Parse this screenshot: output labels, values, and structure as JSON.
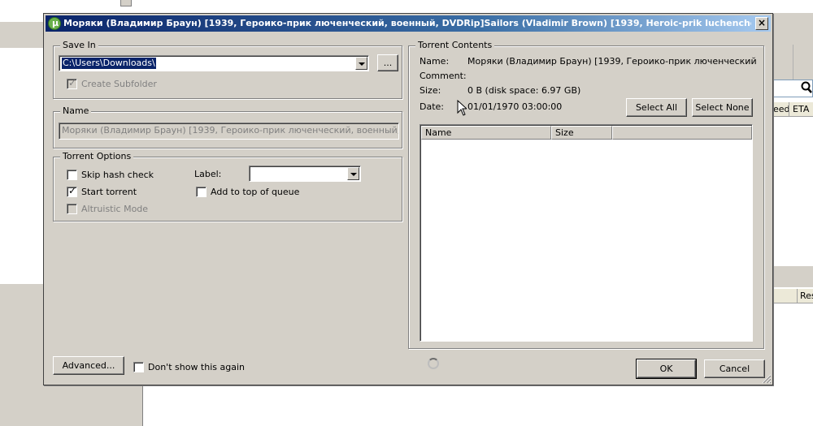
{
  "dialog": {
    "title": "Моряки (Владимир Браун) [1939, Героико-прик люченческий, военный, DVDRip]Sailors (Vladimir Brown) [1939, Heroic-prik luchenchesky, military, ...",
    "close_glyph": "×"
  },
  "save_in": {
    "legend": "Save In",
    "path": "C:\\Users\\Downloads\\",
    "browse_label": "...",
    "create_subfolder_label": "Create Subfolder",
    "create_subfolder_checked": true,
    "create_subfolder_enabled": false
  },
  "name_group": {
    "legend": "Name",
    "value": "Моряки (Владимир Браун) [1939, Героико-прик люченческий, военный, DVDRip]S"
  },
  "torrent_options": {
    "legend": "Torrent Options",
    "skip_hash_label": "Skip hash check",
    "skip_hash_checked": false,
    "start_torrent_label": "Start torrent",
    "start_torrent_checked": true,
    "altruistic_label": "Altruistic Mode",
    "altruistic_enabled": false,
    "label_caption": "Label:",
    "label_value": "",
    "add_top_queue_label": "Add to top of queue",
    "add_top_queue_checked": false
  },
  "torrent_contents": {
    "legend": "Torrent Contents",
    "name_key": "Name:",
    "name_value": "Моряки (Владимир Браун) [1939, Героико-прик люченческий,",
    "comment_key": "Comment:",
    "comment_value": "",
    "size_key": "Size:",
    "size_value": "0 B (disk space: 6.97 GB)",
    "date_key": "Date:",
    "date_value": "01/01/1970 03:00:00",
    "select_all_label": "Select All",
    "select_none_label": "Select None",
    "columns": [
      "Name",
      "Size"
    ]
  },
  "footer": {
    "advanced_label": "Advanced...",
    "dont_show_label": "Don't show this again",
    "dont_show_checked": false,
    "ok_label": "OK",
    "cancel_label": "Cancel"
  },
  "background_app": {
    "col_seed": "eed",
    "col_eta": "ETA",
    "col_res": "Res"
  },
  "icons": [
    "utorrent-logo-icon",
    "close-icon",
    "dropdown-arrow-icon",
    "search-icon",
    "loading-spinner-icon",
    "mouse-cursor-icon",
    "resize-grip-icon"
  ],
  "colors": {
    "dialog_face": "#d4d0c8",
    "titlebar": "#0a246a",
    "selection": "#0a246a",
    "disabled_text": "#808080"
  }
}
